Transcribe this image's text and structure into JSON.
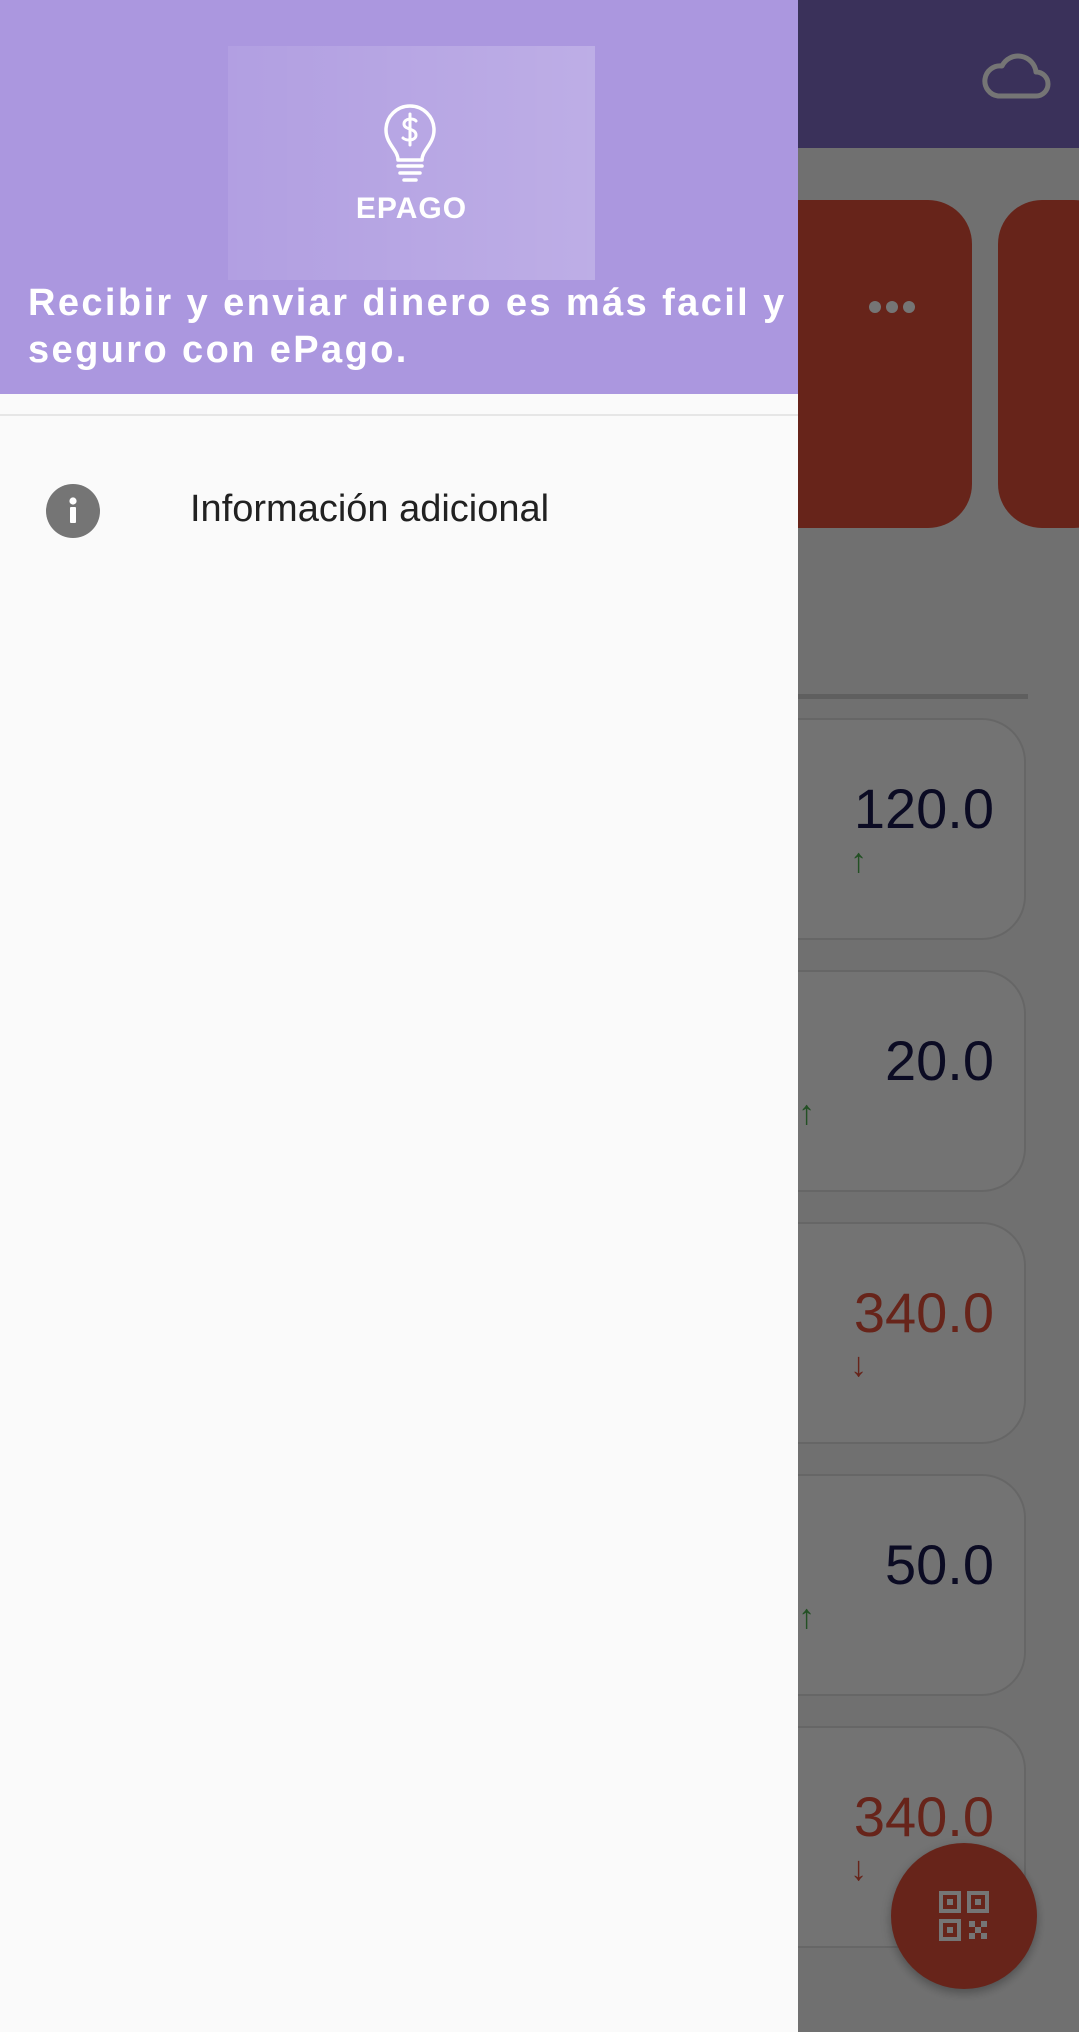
{
  "drawer": {
    "logo_text": "EPAGO",
    "tagline": "Recibir y enviar dinero es más facil y seguro con ePago.",
    "menu_items": [
      {
        "label": "Información adicional",
        "icon": "info-icon"
      }
    ]
  },
  "background": {
    "appbar_action_icon": "cloud-icon",
    "action_card_icon": "more-horiz-icon",
    "transactions": [
      {
        "amount": "120.0",
        "direction": "up",
        "arrow": "↑"
      },
      {
        "amount": "20.0",
        "direction": "up",
        "arrow": "↑"
      },
      {
        "amount": "340.0",
        "direction": "down",
        "arrow": "↓"
      },
      {
        "amount": "50.0",
        "direction": "up",
        "arrow": "↑"
      },
      {
        "amount": "340.0",
        "direction": "down",
        "arrow": "↓"
      }
    ],
    "fab_icon": "qr-code-icon"
  },
  "colors": {
    "drawer_header": "#ab97df",
    "appbar": "#7e6bc4",
    "accent": "#e0503a",
    "amount_in": "#1a1a4e",
    "amount_out": "#e0503a",
    "arrow_up": "#4caf50"
  }
}
